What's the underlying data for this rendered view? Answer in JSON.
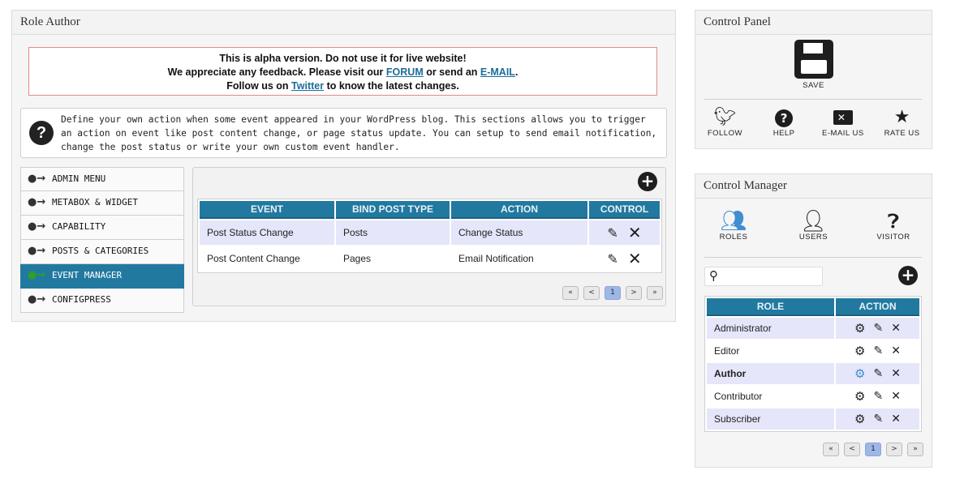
{
  "main": {
    "title": "Role Author",
    "alert": {
      "line1": "This is alpha version. Do not use it for live website!",
      "line2_before": "We appreciate any feedback. Please visit our ",
      "forum_link": "FORUM",
      "line2_middle": " or send an ",
      "email_link": "E-MAIL",
      "line2_after": ".",
      "line3_before": "Follow us on ",
      "twitter_link": "Twitter",
      "line3_after": " to know the latest changes."
    },
    "info_text": "Define your own action when some event appeared in your WordPress blog. This sections allows you to trigger an action on event like post content change, or page status update. You can setup to send email notification, change the post status or write your own custom event handler.",
    "menu": [
      {
        "label": "ADMIN MENU",
        "active": false
      },
      {
        "label": "METABOX & WIDGET",
        "active": false
      },
      {
        "label": "CAPABILITY",
        "active": false
      },
      {
        "label": "POSTS & CATEGORIES",
        "active": false
      },
      {
        "label": "EVENT MANAGER",
        "active": true
      },
      {
        "label": "CONFIGPRESS",
        "active": false
      }
    ],
    "event_table": {
      "headers": [
        "EVENT",
        "BIND POST TYPE",
        "ACTION",
        "CONTROL"
      ],
      "rows": [
        {
          "event": "Post Status Change",
          "post_type": "Posts",
          "action": "Change Status"
        },
        {
          "event": "Post Content Change",
          "post_type": "Pages",
          "action": "Email Notification"
        }
      ]
    },
    "pager": {
      "first": "«",
      "prev": "<",
      "current": "1",
      "next": ">",
      "last": "»"
    }
  },
  "control_panel": {
    "title": "Control Panel",
    "save_label": "SAVE",
    "items": [
      {
        "label": "FOLLOW",
        "icon": "twitter-icon"
      },
      {
        "label": "HELP",
        "icon": "help-icon"
      },
      {
        "label": "E-MAIL US",
        "icon": "email-icon"
      },
      {
        "label": "RATE US",
        "icon": "star-icon"
      }
    ]
  },
  "control_manager": {
    "title": "Control Manager",
    "tabs": [
      {
        "label": "ROLES",
        "icon": "roles-icon"
      },
      {
        "label": "USERS",
        "icon": "users-icon"
      },
      {
        "label": "VISITOR",
        "icon": "visitor-icon"
      }
    ],
    "search_placeholder": "",
    "role_table": {
      "headers": [
        "ROLE",
        "ACTION"
      ],
      "rows": [
        {
          "name": "Administrator",
          "selected": false
        },
        {
          "name": "Editor",
          "selected": false
        },
        {
          "name": "Author",
          "selected": true
        },
        {
          "name": "Contributor",
          "selected": false
        },
        {
          "name": "Subscriber",
          "selected": false
        }
      ]
    },
    "pager": {
      "first": "«",
      "prev": "<",
      "current": "1",
      "next": ">",
      "last": "»"
    }
  },
  "colors": {
    "header_blue": "#2279a0",
    "row_highlight": "#e5e6fa",
    "link": "#1c6c99",
    "alert_border": "#e28a8a"
  }
}
